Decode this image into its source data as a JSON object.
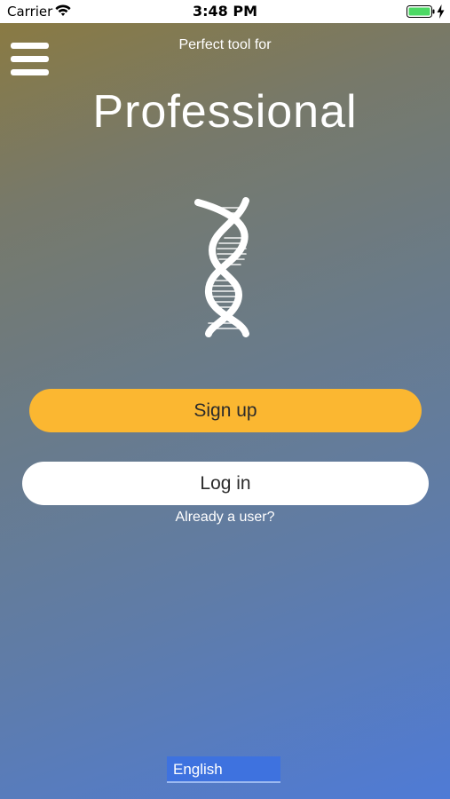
{
  "status_bar": {
    "carrier": "Carrier",
    "time": "3:48 PM",
    "wifi_icon": "wifi-icon",
    "battery_icon": "battery-icon",
    "battery_color": "#4cd964"
  },
  "header": {
    "menu_icon": "hamburger-menu-icon",
    "tagline": "Perfect tool for",
    "title": "Professional"
  },
  "logo": {
    "icon": "dna-helix-icon"
  },
  "actions": {
    "signup_label": "Sign up",
    "login_label": "Log in",
    "already_user_text": "Already a user?"
  },
  "footer": {
    "language_selected": "English"
  },
  "colors": {
    "accent": "#fbb731",
    "login_button": "#ffffff",
    "language_select_bg": "#3e72df"
  }
}
